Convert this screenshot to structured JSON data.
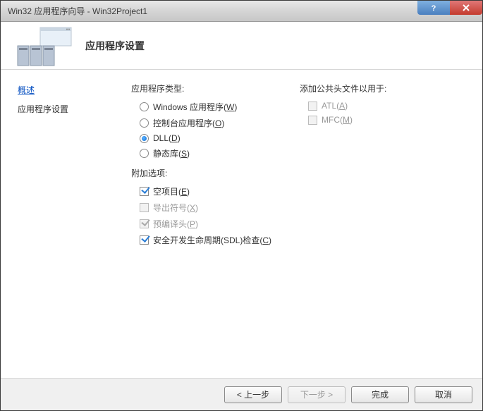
{
  "title": "Win32 应用程序向导 - Win32Project1",
  "header_title": "应用程序设置",
  "nav": {
    "overview": "概述",
    "settings": "应用程序设置"
  },
  "app_type": {
    "label": "应用程序类型:",
    "windows": {
      "text": "Windows 应用程序(",
      "key": "W",
      "suffix": ")",
      "selected": false
    },
    "console": {
      "text": "控制台应用程序(",
      "key": "O",
      "suffix": ")",
      "selected": false
    },
    "dll": {
      "text": "DLL(",
      "key": "D",
      "suffix": ")",
      "selected": true
    },
    "static": {
      "text": "静态库(",
      "key": "S",
      "suffix": ")",
      "selected": false
    }
  },
  "extra": {
    "label": "附加选项:",
    "empty": {
      "text": "空项目(",
      "key": "E",
      "suffix": ")",
      "checked": true,
      "disabled": false
    },
    "export": {
      "text": "导出符号(",
      "key": "X",
      "suffix": ")",
      "checked": false,
      "disabled": true
    },
    "pch": {
      "text": "预编译头(",
      "key": "P",
      "suffix": ")",
      "checked": true,
      "disabled": true
    },
    "sdl": {
      "text": "安全开发生命周期(SDL)检查(",
      "key": "C",
      "suffix": ")",
      "checked": true,
      "disabled": false
    }
  },
  "headers": {
    "label": "添加公共头文件以用于:",
    "atl": {
      "text": "ATL(",
      "key": "A",
      "suffix": ")",
      "checked": false,
      "disabled": true
    },
    "mfc": {
      "text": "MFC(",
      "key": "M",
      "suffix": ")",
      "checked": false,
      "disabled": true
    }
  },
  "buttons": {
    "prev": "< 上一步",
    "next": "下一步 >",
    "finish": "完成",
    "cancel": "取消"
  }
}
